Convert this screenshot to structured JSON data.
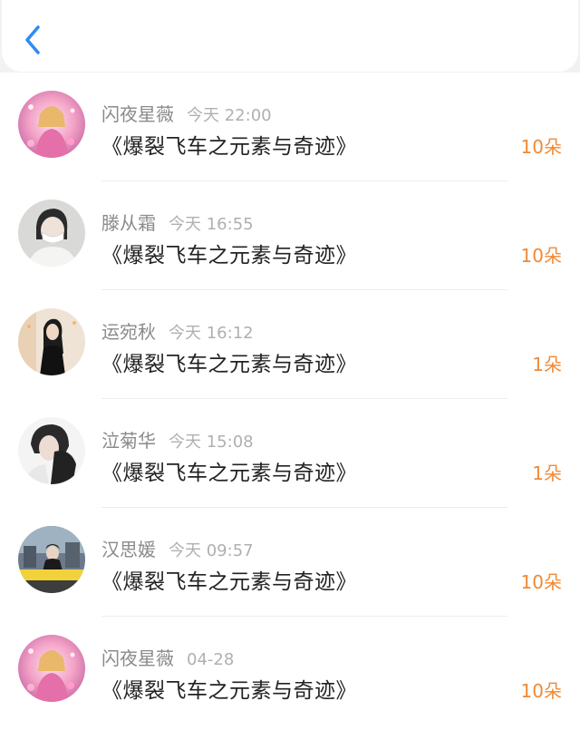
{
  "header": {
    "back_icon": "chevron-left-icon",
    "accent_color": "#2d8cf0"
  },
  "items": [
    {
      "name": "闪夜星薇",
      "time": "今天 22:00",
      "title": "《爆裂飞车之元素与奇迹》",
      "count": "10朵"
    },
    {
      "name": "滕从霜",
      "time": "今天 16:55",
      "title": "《爆裂飞车之元素与奇迹》",
      "count": "10朵"
    },
    {
      "name": "运宛秋",
      "time": "今天 16:12",
      "title": "《爆裂飞车之元素与奇迹》",
      "count": "1朵"
    },
    {
      "name": "泣菊华",
      "time": "今天 15:08",
      "title": "《爆裂飞车之元素与奇迹》",
      "count": "1朵"
    },
    {
      "name": "汉思媛",
      "time": "今天 09:57",
      "title": "《爆裂飞车之元素与奇迹》",
      "count": "10朵"
    },
    {
      "name": "闪夜星薇",
      "time": "04-28",
      "title": "《爆裂飞车之元素与奇迹》",
      "count": "10朵"
    }
  ],
  "colors": {
    "count": "#f08a35",
    "name": "#8a8a8a",
    "time": "#b0b0b0",
    "title": "#222222"
  }
}
